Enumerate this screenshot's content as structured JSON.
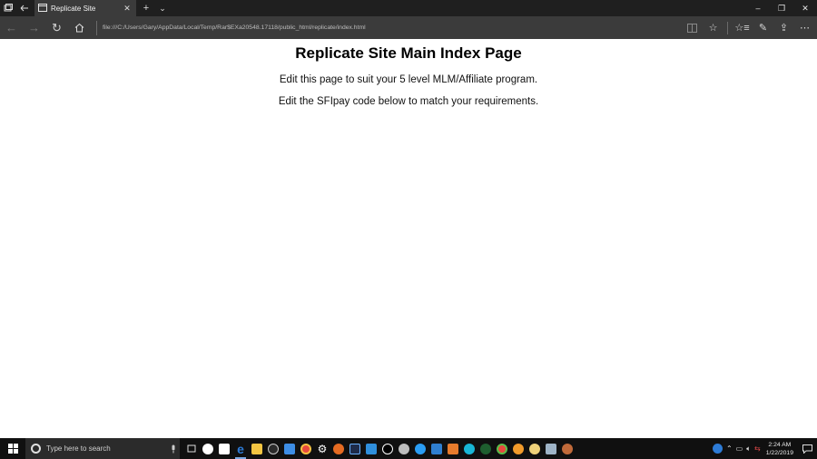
{
  "browser": {
    "tab_title": "Replicate Site",
    "address": "file:///C:/Users/Gary/AppData/Local/Temp/Rar$EXa20548.17118/public_html/replicate/index.html"
  },
  "page": {
    "title": "Replicate Site Main Index Page",
    "line1": "Edit this page to suit your 5 level MLM/Affiliate program.",
    "line2": "Edit the SFIpay code below to match your requirements."
  },
  "taskbar": {
    "search_placeholder": "Type here to search",
    "time": "2:24 AM",
    "date": "1/22/2019"
  },
  "colors": {
    "titlebar": "#1f1f1f",
    "navbar": "#3b3b3b",
    "taskbar": "#101010",
    "edge_blue": "#2d7bd6"
  }
}
